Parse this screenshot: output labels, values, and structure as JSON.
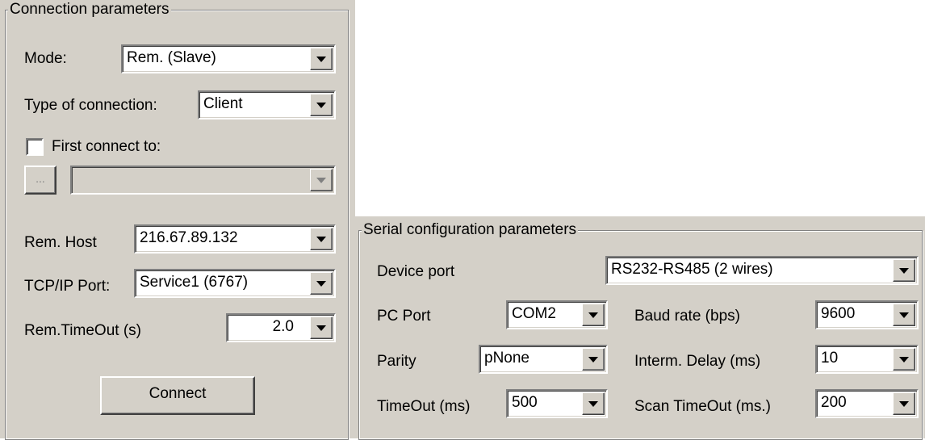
{
  "connection": {
    "title": "Connection parameters",
    "mode": {
      "label": "Mode:",
      "value": "Rem. (Slave)"
    },
    "type_of_connection": {
      "label": "Type of connection:",
      "value": "Client"
    },
    "first_connect": {
      "label": "First connect to:",
      "checked": false,
      "browse_label": "...",
      "value": ""
    },
    "rem_host": {
      "label": "Rem. Host",
      "value": "216.67.89.132"
    },
    "tcp_port": {
      "label": "TCP/IP Port:",
      "value": "Service1 (6767)"
    },
    "rem_timeout": {
      "label": "Rem.TimeOut (s)",
      "value": "2.0"
    },
    "connect_label": "Connect"
  },
  "serial": {
    "title": "Serial configuration parameters",
    "device_port": {
      "label": "Device port",
      "value": "RS232-RS485 (2 wires)"
    },
    "pc_port": {
      "label": "PC Port",
      "value": "COM2"
    },
    "baud_rate": {
      "label": "Baud rate (bps)",
      "value": "9600"
    },
    "parity": {
      "label": "Parity",
      "value": "pNone"
    },
    "interm_delay": {
      "label": "Interm. Delay (ms)",
      "value": "10"
    },
    "timeout": {
      "label": "TimeOut (ms)",
      "value": "500"
    },
    "scan_timeout": {
      "label": "Scan TimeOut (ms.)",
      "value": "200"
    }
  },
  "colors": {
    "face": "#d4d0c8",
    "shadow": "#808080",
    "highlight": "#ffffff"
  }
}
